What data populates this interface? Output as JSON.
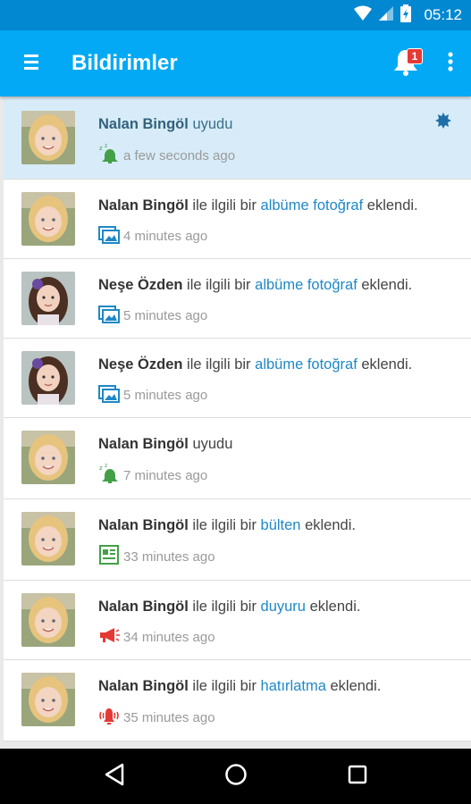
{
  "status_bar": {
    "time": "05:12"
  },
  "app_bar": {
    "title": "Bildirimler",
    "badge_count": "1"
  },
  "notifications": [
    {
      "name": "Nalan Bingöl",
      "text_before": " ",
      "link": "",
      "text_after": "",
      "verb": "uyudu",
      "time": "a few seconds ago",
      "icon": "sleep-icon",
      "unread": true
    },
    {
      "name": "Nalan Bingöl",
      "text_before": " ile ilgili bir ",
      "link": "albüme fotoğraf",
      "text_after": " eklendi.",
      "verb": "",
      "time": "4 minutes ago",
      "icon": "photo-album-icon",
      "unread": false
    },
    {
      "name": "Neşe Özden",
      "text_before": " ile ilgili bir ",
      "link": "albüme fotoğraf",
      "text_after": " eklendi.",
      "verb": "",
      "time": "5 minutes ago",
      "icon": "photo-album-icon",
      "unread": false
    },
    {
      "name": "Neşe Özden",
      "text_before": " ile ilgili bir ",
      "link": "albüme fotoğraf",
      "text_after": " eklendi.",
      "verb": "",
      "time": "5 minutes ago",
      "icon": "photo-album-icon",
      "unread": false
    },
    {
      "name": "Nalan Bingöl",
      "text_before": " ",
      "link": "",
      "text_after": "",
      "verb": "uyudu",
      "time": "7 minutes ago",
      "icon": "sleep-icon",
      "unread": false
    },
    {
      "name": "Nalan Bingöl",
      "text_before": " ile ilgili bir ",
      "link": "bülten",
      "text_after": " eklendi.",
      "verb": "",
      "time": "33 minutes ago",
      "icon": "bulletin-icon",
      "unread": false
    },
    {
      "name": "Nalan Bingöl",
      "text_before": " ile ilgili bir ",
      "link": "duyuru",
      "text_after": " eklendi.",
      "verb": "",
      "time": "34 minutes ago",
      "icon": "megaphone-icon",
      "unread": false
    },
    {
      "name": "Nalan Bingöl",
      "text_before": " ile ilgili bir ",
      "link": "hatırlatma",
      "text_after": " eklendi.",
      "verb": "",
      "time": "35 minutes ago",
      "icon": "alarm-icon",
      "unread": false
    }
  ],
  "colors": {
    "app_bar": "#03a9f4",
    "status_bar": "#0288d1",
    "link": "#1e88c7",
    "unread_bg": "#d7ecf8",
    "badge": "#e53935"
  }
}
